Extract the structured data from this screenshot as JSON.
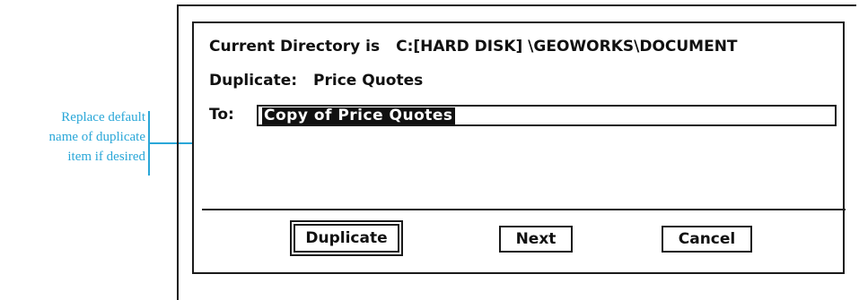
{
  "annotation": {
    "lines": [
      "Replace default",
      "name of duplicate",
      "item if desired"
    ]
  },
  "dialog": {
    "directory_label": "Current Directory is",
    "directory_path": "C:[HARD DISK] \\GEOWORKS\\DOCUMENT",
    "duplicate_label": "Duplicate:",
    "duplicate_name": "Price Quotes",
    "to_label": "To:",
    "to_value": "Copy of Price Quotes",
    "buttons": {
      "duplicate": "Duplicate",
      "next": "Next",
      "cancel": "Cancel"
    }
  },
  "colors": {
    "annotation": "#2aa7d8",
    "ink": "#1a1a1a"
  }
}
